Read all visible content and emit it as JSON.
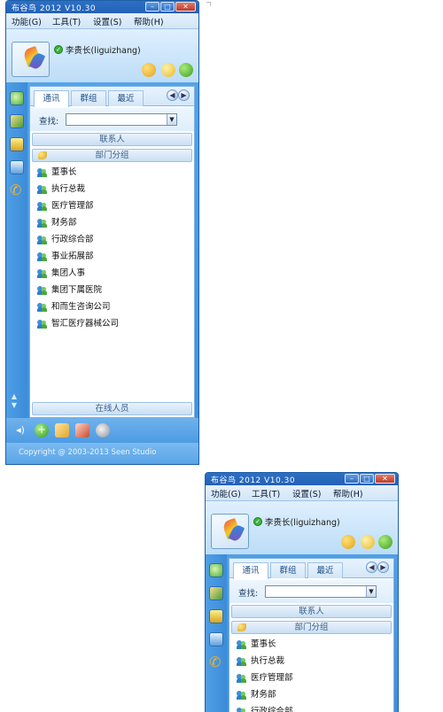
{
  "app": {
    "title": "布谷鸟 2012  V10.30",
    "menu": [
      "功能(G)",
      "工具(T)",
      "设置(S)",
      "帮助(H)"
    ],
    "user_name": "李贵长(liguizhang)"
  },
  "tabs": [
    "通讯",
    "群组",
    "最近"
  ],
  "search": {
    "label": "查找:",
    "value": ""
  },
  "groups": {
    "contacts": "联系人",
    "departments": "部门分组",
    "online": "在线人员"
  },
  "departments": [
    "董事长",
    "执行总裁",
    "医疗管理部",
    "财务部",
    "行政综合部",
    "事业拓展部",
    "集团人事",
    "集团下属医院",
    "和而生咨询公司",
    "智汇医疗器械公司"
  ],
  "footer": {
    "copyright": "Copyright @ 2003-2013 Seen Studio"
  },
  "colors": {
    "title_bar": "#2262b6",
    "window_body": "#3d8fdc",
    "accent_text": "#3b5f87"
  },
  "icons": {
    "window_buttons": [
      "minimize-icon",
      "maximize-icon",
      "close-icon"
    ],
    "toolbar": [
      "skin-icon",
      "search-icon",
      "qq-icon"
    ],
    "sidebar": [
      "contacts-icon",
      "photo-icon",
      "message-icon",
      "info-icon",
      "phone-icon"
    ],
    "bottom": [
      "volume-icon",
      "add-icon",
      "folder-icon",
      "mail-icon",
      "settings-icon"
    ]
  }
}
